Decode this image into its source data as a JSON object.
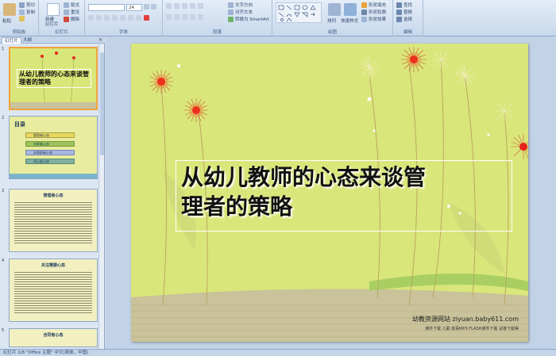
{
  "ribbon": {
    "clipboard": {
      "label": "剪贴板",
      "paste": "粘贴",
      "cut": "剪切",
      "copy": "复制",
      "format_painter": "格式刷"
    },
    "slides": {
      "label": "幻灯片",
      "new_slide": "新建\n幻灯片",
      "layout": "版式",
      "reset": "重设",
      "delete": "删除"
    },
    "font": {
      "label": "字体",
      "font_name": "",
      "font_size": "24"
    },
    "paragraph": {
      "label": "段落",
      "text_direction": "文字方向",
      "align_text": "对齐文本",
      "smartart": "转换为 SmartArt"
    },
    "drawing": {
      "label": "绘图",
      "arrange": "排列",
      "quick_styles": "快速样式",
      "shape_fill": "形状填充",
      "shape_outline": "形状轮廓",
      "shape_effects": "形状效果"
    },
    "editing": {
      "label": "编辑",
      "find": "查找",
      "replace": "替换",
      "select": "选择"
    }
  },
  "panel": {
    "tabs": [
      "幻灯片",
      "大纲"
    ],
    "close": "×",
    "thumbnails": [
      {
        "num": "1",
        "title": "从幼儿教师的心态来谈管理者的策略"
      },
      {
        "num": "2",
        "title": "目录",
        "items": [
          "管理者心态",
          "光辉者心态",
          "关照顾者心态",
          "同心者心态"
        ]
      },
      {
        "num": "3",
        "title": "管理者心态"
      },
      {
        "num": "4",
        "title": "关注需要心态"
      },
      {
        "num": "5",
        "title": "合同者心态"
      }
    ]
  },
  "slide": {
    "title": "从幼儿教师的心态来谈管\n理者的策略",
    "site": "幼教资源网站  ziyuan.baby611.com",
    "site_sub": "课件下载   儿歌   故事MP3   FLASH课件下载   试卷下载等"
  },
  "status": {
    "text": "幻灯片 1/8   \"Office 主题\"   中文(简体，中国)"
  },
  "colors": {
    "slide_bg": "#d9e67a",
    "flower_red": "#e8231a",
    "ribbon_bg": "#dbe6f4"
  }
}
